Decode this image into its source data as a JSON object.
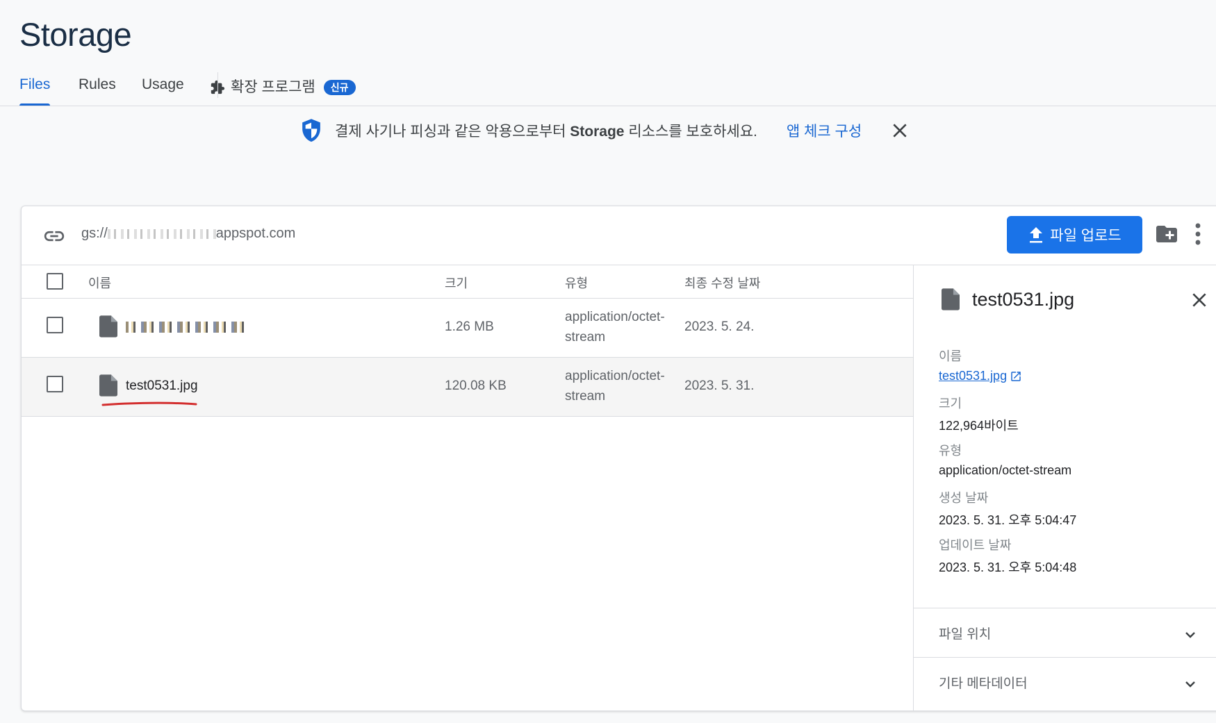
{
  "page": {
    "title": "Storage"
  },
  "tabs": {
    "files": "Files",
    "rules": "Rules",
    "usage": "Usage",
    "extensions": "확장 프로그램",
    "extensions_badge": "신규"
  },
  "banner": {
    "text_before": "결제 사기나 피싱과 같은 악용으로부터 ",
    "text_bold": "Storage",
    "text_after": " 리소스를 보호하세요.",
    "link": "앱 체크 구성"
  },
  "bucket": {
    "prefix": "gs://",
    "suffix": "appspot.com",
    "upload_label": "파일 업로드"
  },
  "table": {
    "headers": {
      "name": "이름",
      "size": "크기",
      "type": "유형",
      "modified": "최종 수정 날짜"
    },
    "rows": [
      {
        "name": "",
        "size": "1.26 MB",
        "type_line1": "application/octet-",
        "type_line2": "stream",
        "modified": "2023. 5. 24."
      },
      {
        "name": "test0531.jpg",
        "size": "120.08 KB",
        "type_line1": "application/octet-",
        "type_line2": "stream",
        "modified": "2023. 5. 31."
      }
    ]
  },
  "details": {
    "title": "test0531.jpg",
    "name_label": "이름",
    "name_value": "test0531.jpg",
    "size_label": "크기",
    "size_value": "122,964바이트",
    "type_label": "유형",
    "type_value": "application/octet-stream",
    "created_label": "생성 날짜",
    "created_value": "2023. 5. 31. 오후 5:04:47",
    "updated_label": "업데이트 날짜",
    "updated_value": "2023. 5. 31. 오후 5:04:48",
    "location_label": "파일 위치",
    "metadata_label": "기타 메타데이터"
  },
  "colors": {
    "accent": "#1a73e8",
    "annotation": "#d32f2f"
  }
}
